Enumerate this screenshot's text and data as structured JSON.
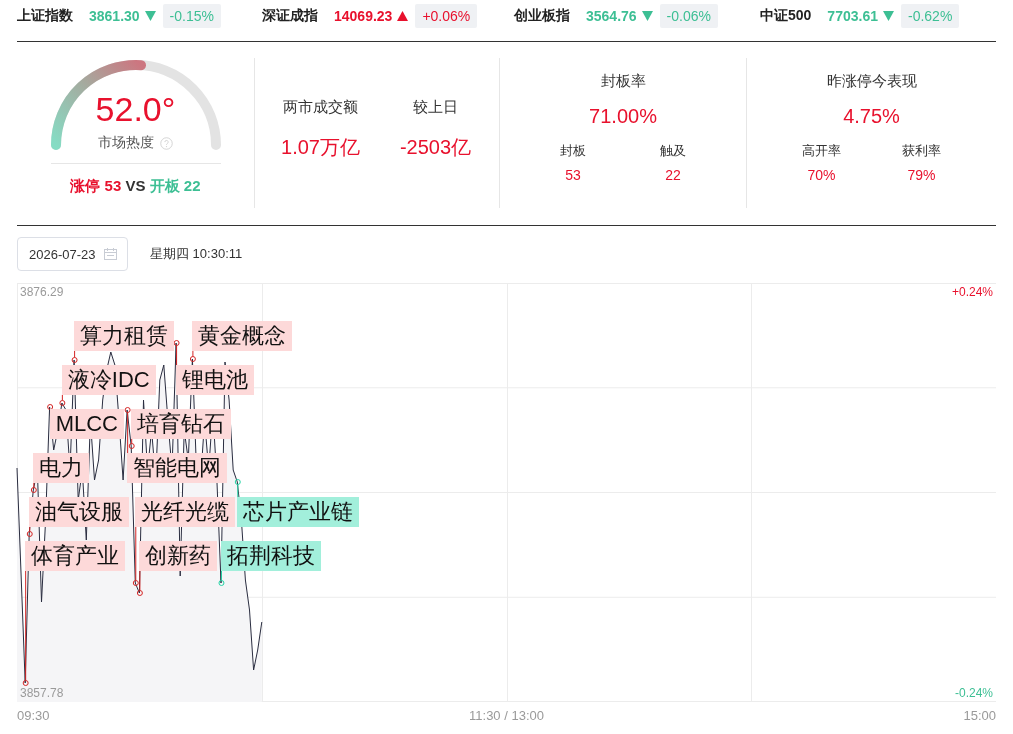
{
  "indices": [
    {
      "name": "上证指数",
      "value": "3861.30",
      "change": "-0.15%",
      "rising": false
    },
    {
      "name": "深证成指",
      "value": "14069.23",
      "change": "+0.06%",
      "rising": true
    },
    {
      "name": "创业板指",
      "value": "3564.76",
      "change": "-0.06%",
      "rising": false
    },
    {
      "name": "中证500",
      "value": "7703.61",
      "change": "-0.62%",
      "rising": false
    }
  ],
  "gauge": {
    "value": "52.0°",
    "label": "市场热度",
    "level": 0.52
  },
  "limit_summary": {
    "limit_up_label": "涨停",
    "limit_up_count": "53",
    "vs": "VS",
    "opened_label": "开板",
    "opened_count": "22"
  },
  "turnover": [
    {
      "label": "两市成交额",
      "value": "1.07万亿"
    },
    {
      "label": "较上日",
      "value": "-2503亿"
    }
  ],
  "seal_rate": {
    "title": "封板率",
    "value": "71.00%",
    "items": [
      {
        "label": "封板",
        "value": "53"
      },
      {
        "label": "触及",
        "value": "22"
      }
    ]
  },
  "prev_limit_up": {
    "title": "昨涨停今表现",
    "value": "4.75%",
    "items": [
      {
        "label": "高开率",
        "value": "70%"
      },
      {
        "label": "获利率",
        "value": "79%"
      }
    ]
  },
  "date_field": {
    "value": "2026-07-23"
  },
  "timestamp": "星期四 10:30:11",
  "chart": {
    "price_labels": [
      "3876.29",
      "3857.78"
    ],
    "percent_labels": [
      {
        "label": "+0.24%",
        "rising": true
      },
      {
        "label": "-0.24%",
        "rising": false
      }
    ],
    "time_labels": [
      "09:30",
      "11:30 / 13:00",
      "15:00"
    ],
    "tag_rows": [
      {
        "tags": [
          {
            "text": "算力租赁",
            "color": "#fdd9d9"
          },
          {
            "text": "黄金概念",
            "color": "#fdd9d9"
          }
        ]
      },
      {
        "tags": [
          {
            "text": "液冷IDC",
            "color": "#fdd9d9"
          },
          {
            "text": "锂电池",
            "color": "#fdd9d9"
          }
        ]
      },
      {
        "tags": [
          {
            "text": "MLCC",
            "color": "#fdd9d9"
          },
          {
            "text": "培育钻石",
            "color": "#fdd9d9"
          }
        ]
      },
      {
        "tags": [
          {
            "text": "电力",
            "color": "#fdd9d9"
          },
          {
            "text": "智能电网",
            "color": "#fdd9d9"
          }
        ]
      },
      {
        "tags": [
          {
            "text": "油气设服",
            "color": "#fdd9d9"
          },
          {
            "text": "光纤光缆",
            "color": "#fdd9d9"
          },
          {
            "text": "芯片产业链",
            "color": "#a2efdb"
          }
        ]
      },
      {
        "tags": [
          {
            "text": "体育产业",
            "color": "#fdd9d9"
          },
          {
            "text": "创新药",
            "color": "#fdd9d9"
          },
          {
            "text": "拓荆科技",
            "color": "#a2efdb"
          }
        ]
      }
    ]
  }
}
